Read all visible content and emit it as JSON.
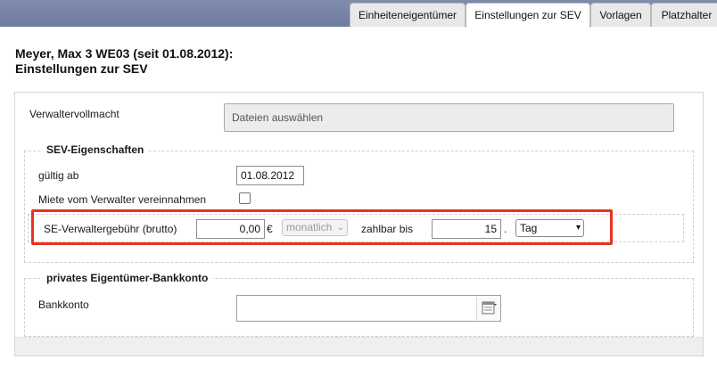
{
  "tabs": [
    {
      "label": "Einheiteneigentümer",
      "active": false
    },
    {
      "label": "Einstellungen zur SEV",
      "active": true
    },
    {
      "label": "Vorlagen",
      "active": false
    },
    {
      "label": "Platzhalter",
      "active": false
    }
  ],
  "page": {
    "title_line1": "Meyer, Max 3 WE03 (seit 01.08.2012):",
    "title_line2": "Einstellungen zur SEV"
  },
  "vollmacht": {
    "label": "Verwaltervollmacht",
    "file_button": "Dateien auswählen"
  },
  "sev": {
    "legend": "SEV-Eigenschaften",
    "gueltig_label": "gültig ab",
    "gueltig_value": "01.08.2012",
    "miete_label": "Miete vom Verwalter vereinnahmen",
    "miete_checked": false,
    "fee_label": "SE-Verwaltergebühr (brutto)",
    "fee_value": "0,00",
    "currency": "€",
    "interval_value": "monatlich",
    "zahlbar_label": "zahlbar bis",
    "zahlbar_value": "15",
    "dot": ".",
    "unit_value": "Tag",
    "highlight_color": "#e8321f"
  },
  "bank": {
    "legend": "privates Eigentümer-Bankkonto",
    "label": "Bankkonto",
    "value": ""
  }
}
